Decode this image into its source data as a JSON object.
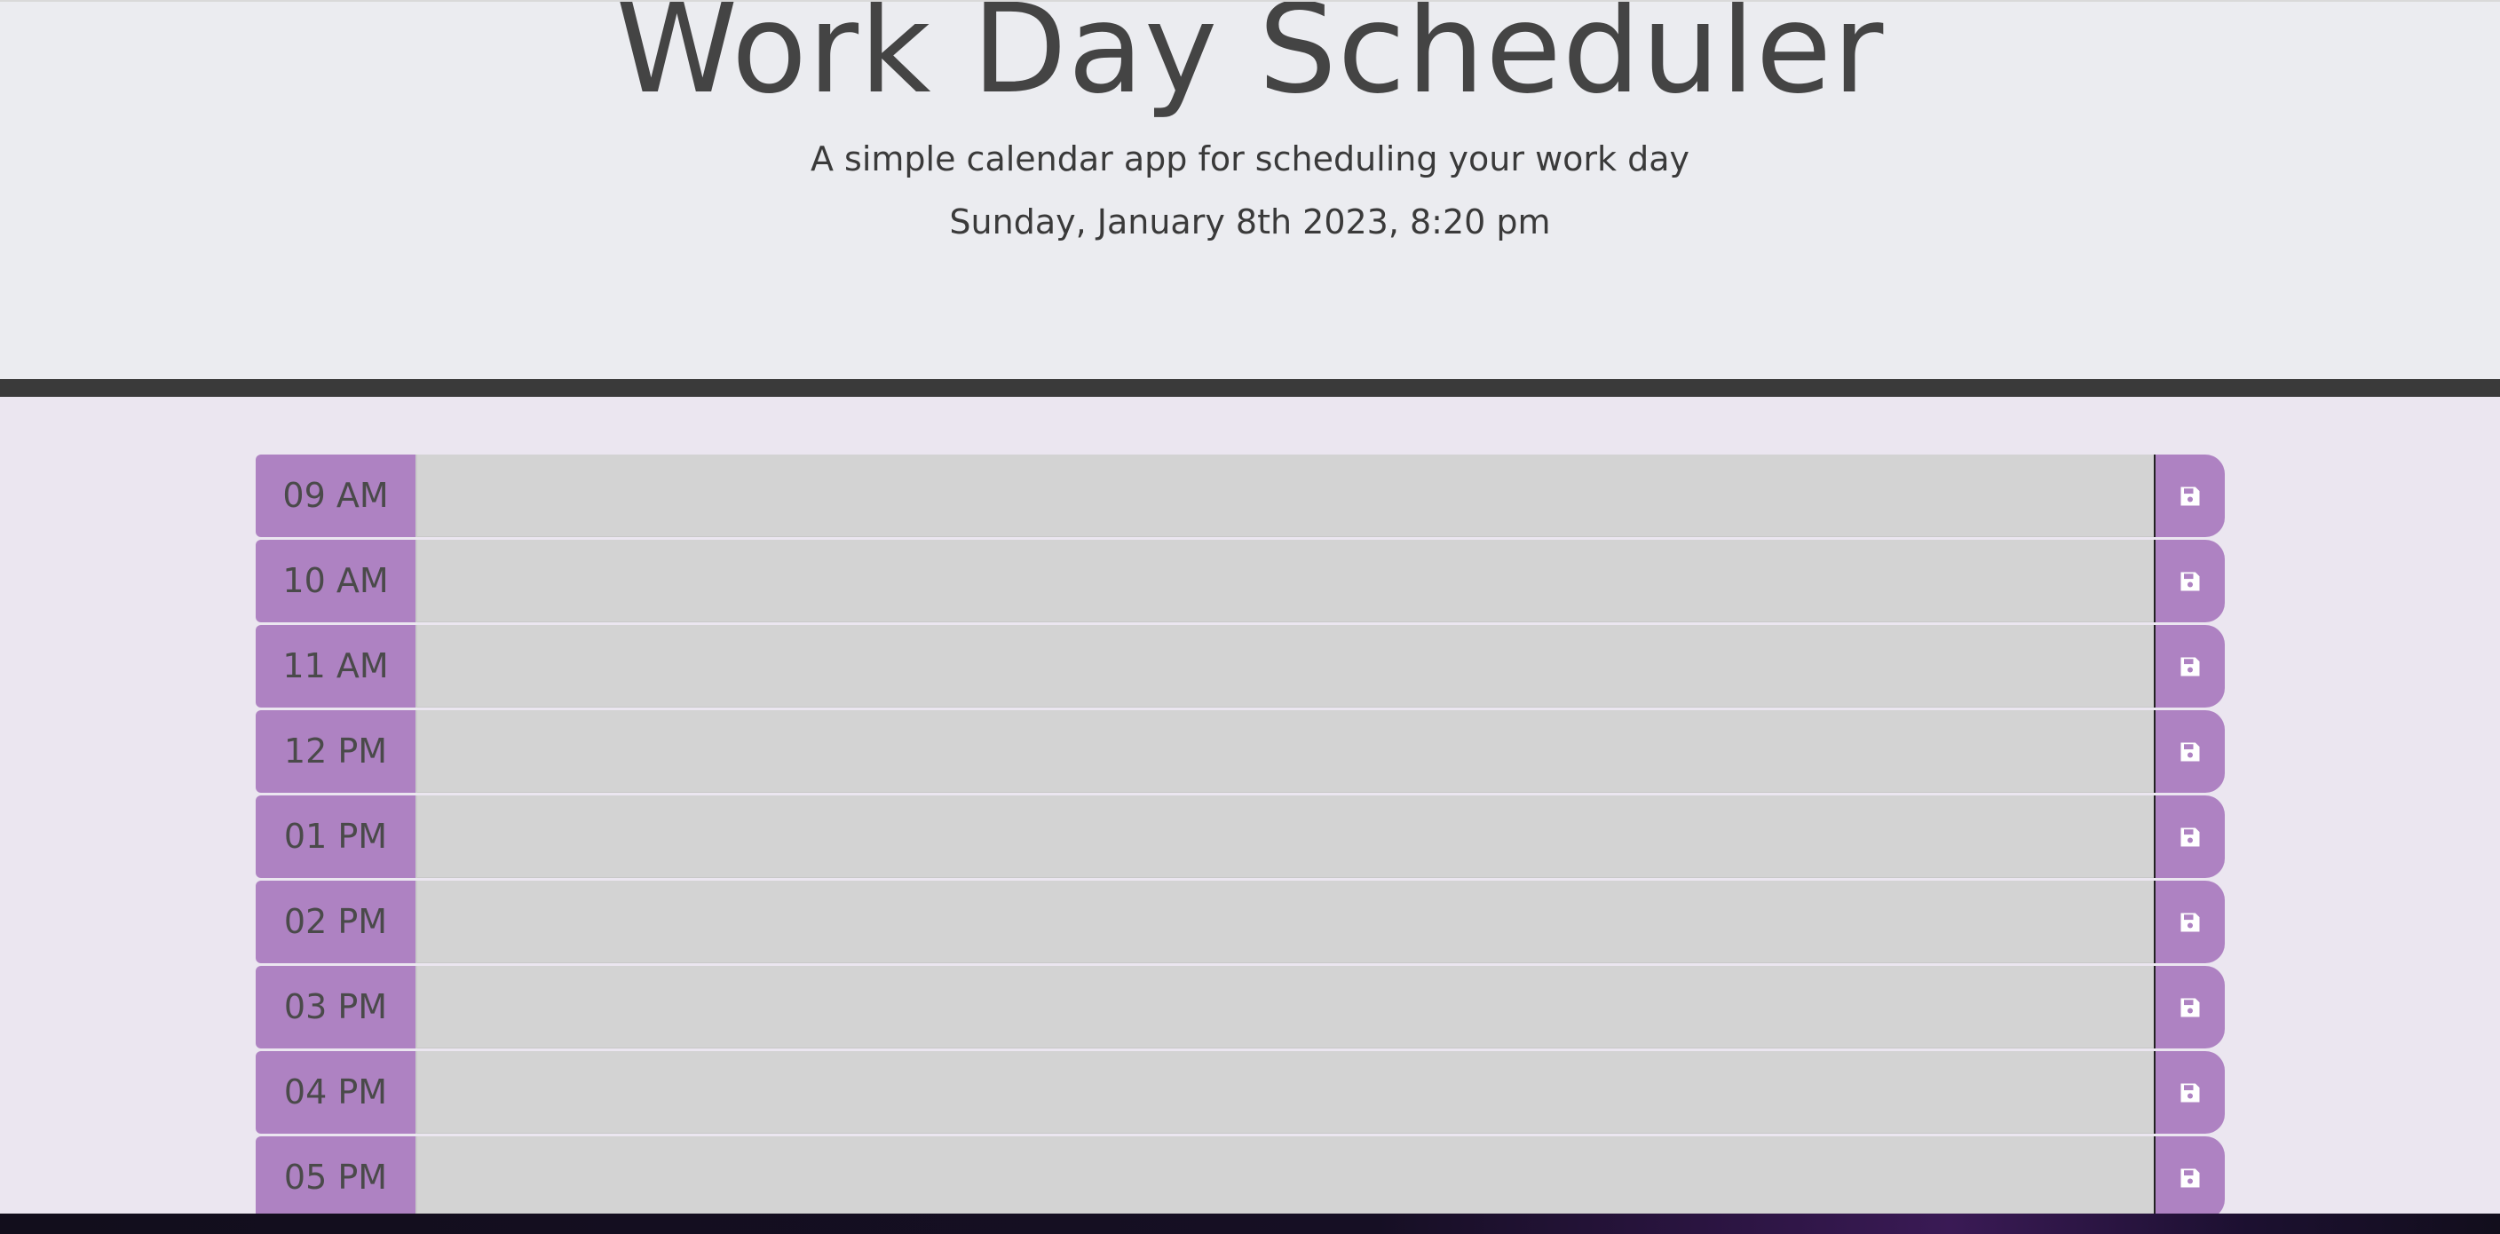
{
  "header": {
    "title": "Work Day Scheduler",
    "subtitle": "A simple calendar app for scheduling your work day",
    "current_day": "Sunday, January 8th 2023, 8:20 pm"
  },
  "colors": {
    "hour_label_bg": "#ae82c2",
    "description_bg": "#d3d3d3",
    "header_bg": "#ebecf0",
    "divider": "#3a3a3a",
    "text": "#444444"
  },
  "schedule": {
    "time_blocks": [
      {
        "hour": "09 AM",
        "description": "",
        "icon": "save-icon"
      },
      {
        "hour": "10 AM",
        "description": "",
        "icon": "save-icon"
      },
      {
        "hour": "11 AM",
        "description": "",
        "icon": "save-icon"
      },
      {
        "hour": "12 PM",
        "description": "",
        "icon": "save-icon"
      },
      {
        "hour": "01 PM",
        "description": "",
        "icon": "save-icon"
      },
      {
        "hour": "02 PM",
        "description": "",
        "icon": "save-icon"
      },
      {
        "hour": "03 PM",
        "description": "",
        "icon": "save-icon"
      },
      {
        "hour": "04 PM",
        "description": "",
        "icon": "save-icon"
      },
      {
        "hour": "05 PM",
        "description": "",
        "icon": "save-icon"
      }
    ]
  }
}
